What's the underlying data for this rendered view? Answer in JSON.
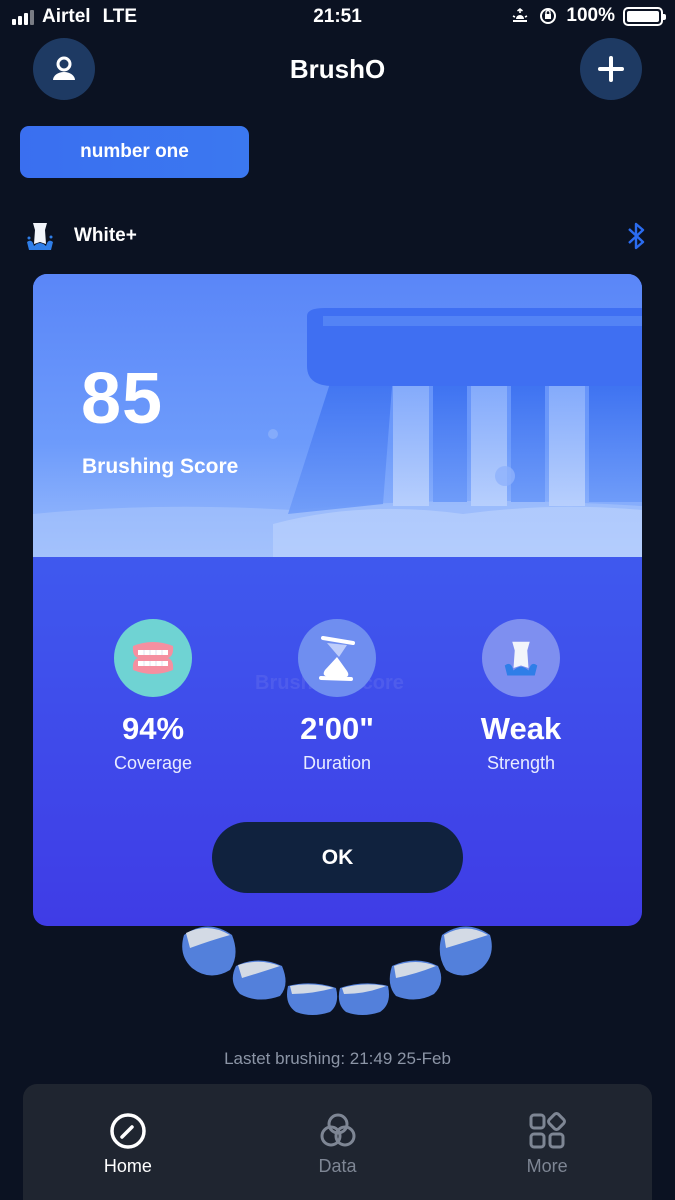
{
  "status_bar": {
    "carrier": "Airtel",
    "network": "LTE",
    "time": "21:51",
    "battery": "100%"
  },
  "header": {
    "title": "BrushO",
    "profile_icon": "user-icon",
    "add_icon": "plus-icon"
  },
  "device": {
    "name": "number one"
  },
  "mode": {
    "label": "White+",
    "bluetooth_icon": "bluetooth-icon"
  },
  "score_card": {
    "score": "85",
    "score_label": "Brushing Score",
    "ghost_label": "Brushing Score",
    "metrics": [
      {
        "value": "94%",
        "label": "Coverage",
        "icon": "teeth-icon",
        "color": "#6fd3d3"
      },
      {
        "value": "2'00\"",
        "label": "Duration",
        "icon": "hourglass-icon",
        "color": "#6f8ef0"
      },
      {
        "value": "Weak",
        "label": "Strength",
        "icon": "tooth-splash-icon",
        "color": "#7e8ff0"
      }
    ],
    "ok_label": "OK"
  },
  "latest_brushing": "Lastet brushing: 21:49 25-Feb",
  "tabs": [
    {
      "label": "Home",
      "icon": "compass-icon",
      "active": true
    },
    {
      "label": "Data",
      "icon": "circles-icon",
      "active": false
    },
    {
      "label": "More",
      "icon": "grid-icon",
      "active": false
    }
  ],
  "colors": {
    "background": "#0b1222",
    "accent": "#3a6ff0",
    "card": "#4a6ff5",
    "button_dark": "#10223e",
    "tab_bar": "#1f2530"
  }
}
